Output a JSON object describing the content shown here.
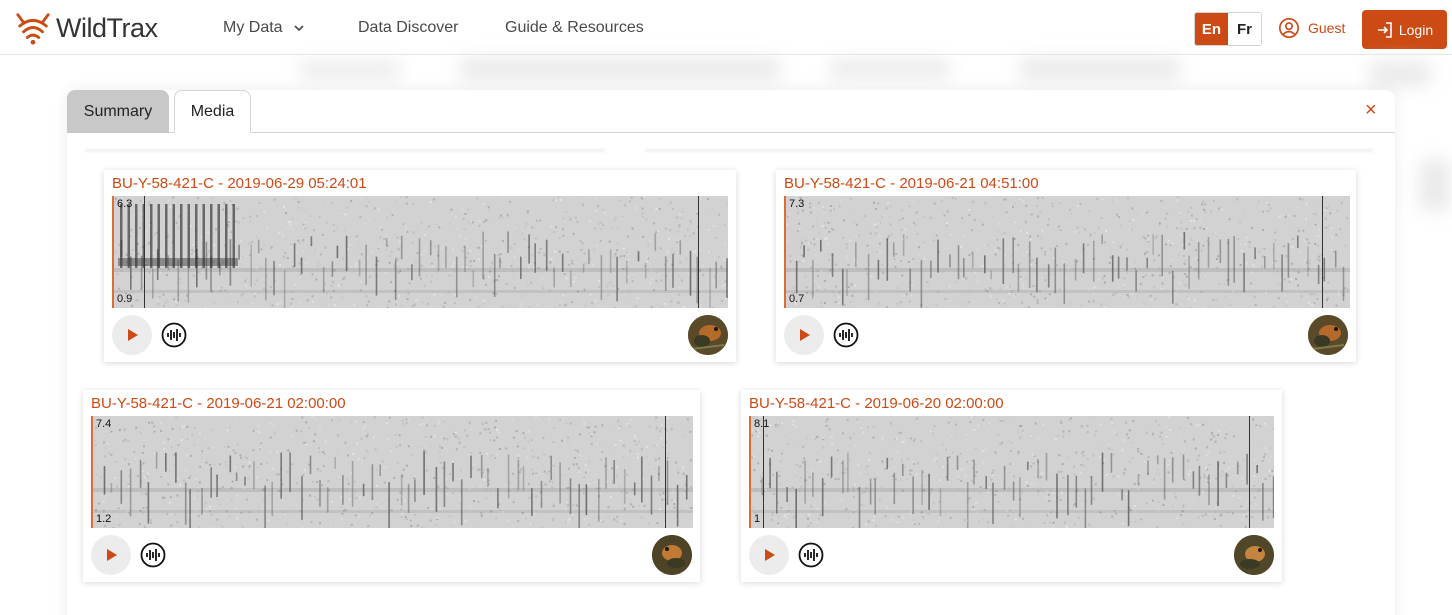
{
  "app": {
    "name": "WildTrax"
  },
  "nav": {
    "my_data": "My Data",
    "data_discover": "Data Discover",
    "guide_resources": "Guide & Resources"
  },
  "lang": {
    "en": "En",
    "fr": "Fr",
    "active": "En"
  },
  "user": {
    "guest_label": "Guest",
    "login_label": "Login"
  },
  "modal": {
    "tabs": [
      {
        "label": "Summary",
        "active": true
      },
      {
        "label": "Media",
        "active": false
      }
    ],
    "close": "×"
  },
  "recordings": [
    {
      "title": "BU-Y-58-421-C - 2019-06-29 05:24:01",
      "freq_top": "6.3",
      "freq_bottom": "0.9"
    },
    {
      "title": "BU-Y-58-421-C - 2019-06-21 04:51:00",
      "freq_top": "7.3",
      "freq_bottom": "0.7"
    },
    {
      "title": "BU-Y-58-421-C - 2019-06-21 02:00:00",
      "freq_top": "7.4",
      "freq_bottom": "1.2"
    },
    {
      "title": "BU-Y-58-421-C - 2019-06-20 02:00:00",
      "freq_top": "8.1",
      "freq_bottom": "1"
    }
  ],
  "icons": {
    "logo": "wildtrax-logo-icon",
    "chevron": "chevron-down-icon",
    "user": "user-circle-icon",
    "login": "login-arrow-icon",
    "close": "close-icon",
    "play": "play-icon",
    "waveform": "waveform-icon"
  },
  "colors": {
    "accent": "#cc4a14",
    "tab_inactive": "#c8c8c8"
  }
}
